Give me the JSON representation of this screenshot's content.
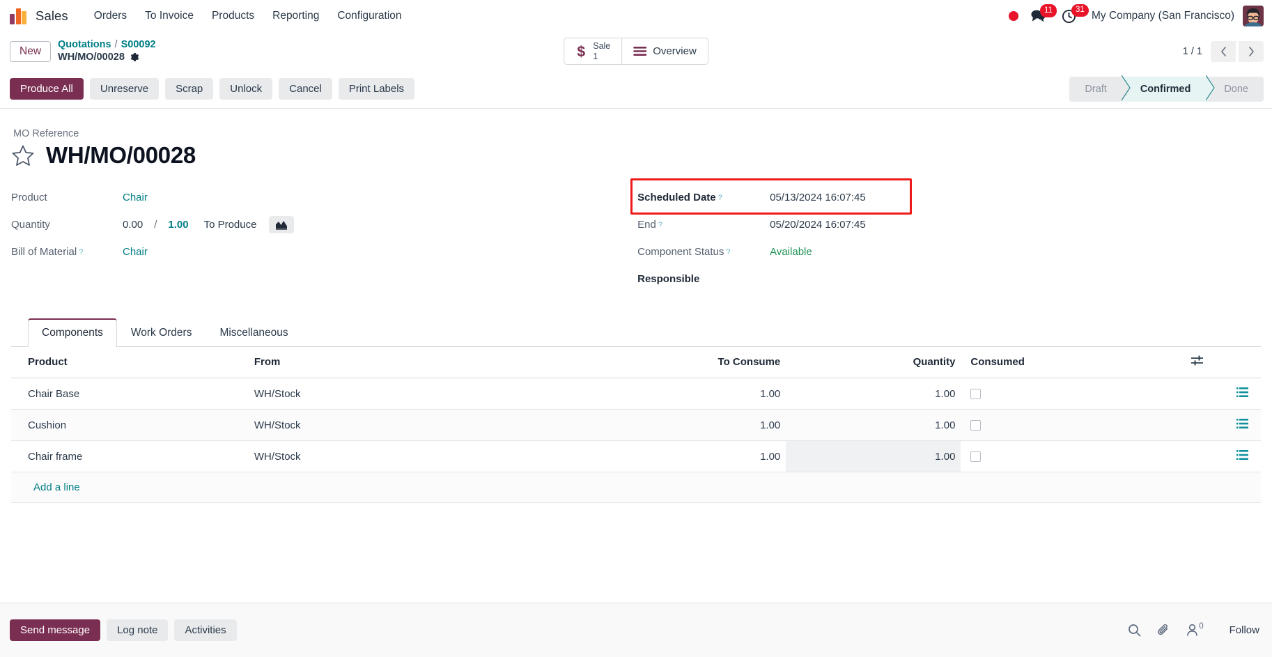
{
  "navbar": {
    "brand": "Sales",
    "menu": [
      {
        "label": "Orders"
      },
      {
        "label": "To Invoice"
      },
      {
        "label": "Products"
      },
      {
        "label": "Reporting"
      },
      {
        "label": "Configuration"
      }
    ],
    "recording_indicator": "recording-dot",
    "messages_badge": "11",
    "activities_badge": "31",
    "company": "My Company (San Francisco)"
  },
  "control_panel": {
    "new_button": "New",
    "breadcrumb": {
      "parent": "Quotations",
      "separator": "/",
      "parent_record": "S00092",
      "current": "WH/MO/00028"
    },
    "stat_buttons": [
      {
        "icon": "dollar-icon",
        "label": "Sale",
        "value": "1"
      },
      {
        "icon": "list-icon",
        "label": "Overview",
        "value": ""
      }
    ],
    "pager": {
      "text": "1 / 1",
      "prev": "‹",
      "next": "›"
    }
  },
  "actions": {
    "primary": "Produce All",
    "secondary": [
      "Unreserve",
      "Scrap",
      "Unlock",
      "Cancel",
      "Print Labels"
    ]
  },
  "statusbar": {
    "states": [
      {
        "label": "Draft",
        "active": false
      },
      {
        "label": "Confirmed",
        "active": true
      },
      {
        "label": "Done",
        "active": false
      }
    ]
  },
  "form": {
    "title_label": "MO Reference",
    "title": "WH/MO/00028",
    "left_fields": [
      {
        "label": "Product",
        "value": "Chair",
        "type": "link"
      },
      {
        "label": "Quantity",
        "qty_done": "0.00",
        "qty_sep": "/",
        "qty_total": "1.00",
        "suffix": "To Produce",
        "type": "quantity"
      },
      {
        "label": "Bill of Material",
        "help": "?",
        "value": "Chair",
        "type": "link"
      }
    ],
    "right_fields": [
      {
        "label": "Scheduled Date",
        "help": "?",
        "value": "05/13/2024 16:07:45",
        "highlighted": true
      },
      {
        "label": "End",
        "help": "?",
        "value": "05/20/2024 16:07:45"
      },
      {
        "label": "Component Status",
        "help": "?",
        "value": "Available",
        "value_color": "#1f9254"
      },
      {
        "label": "Responsible",
        "value": "",
        "bold": true
      }
    ],
    "highlight_color": "#ef1b1b"
  },
  "notebook": {
    "tabs": [
      {
        "label": "Components",
        "active": true
      },
      {
        "label": "Work Orders",
        "active": false
      },
      {
        "label": "Miscellaneous",
        "active": false
      }
    ]
  },
  "components_table": {
    "columns": [
      "Product",
      "From",
      "To Consume",
      "Quantity",
      "Consumed"
    ],
    "rows": [
      {
        "product": "Chair Base",
        "from": "WH/Stock",
        "to_consume": "1.00",
        "quantity": "1.00",
        "consumed": false,
        "focused": false
      },
      {
        "product": "Cushion",
        "from": "WH/Stock",
        "to_consume": "1.00",
        "quantity": "1.00",
        "consumed": false,
        "focused": false
      },
      {
        "product": "Chair frame",
        "from": "WH/Stock",
        "to_consume": "1.00",
        "quantity": "1.00",
        "consumed": false,
        "focused": true
      }
    ],
    "add_line": "Add a line",
    "optional_columns_icon": "sliders-icon"
  },
  "chatter": {
    "send_message": "Send message",
    "log_note": "Log note",
    "activities": "Activities",
    "search_icon": "search-icon",
    "attachment_icon": "paperclip-icon",
    "followers_icon": "user-icon",
    "followers_count": "0",
    "follow_button": "Follow"
  },
  "colors": {
    "primary": "#7a2e52",
    "link": "#017e84",
    "badge": "#e8142a",
    "active_state_bg": "#e6f4f3",
    "success": "#1f9254",
    "highlight": "#ef1b1b"
  }
}
